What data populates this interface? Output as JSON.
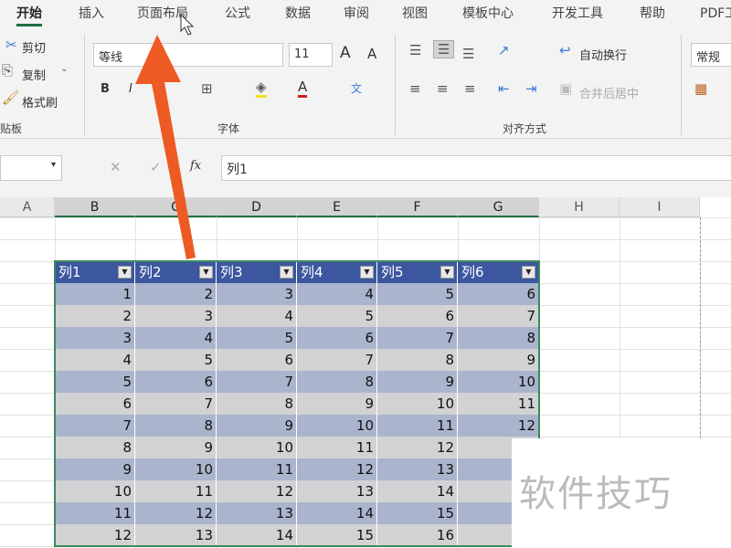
{
  "tabs": [
    "开始",
    "插入",
    "页面布局",
    "公式",
    "数据",
    "审阅",
    "视图",
    "模板中心",
    "开发工具",
    "帮助",
    "PDF工"
  ],
  "clipboard": {
    "cut": "剪切",
    "copy": "复制",
    "format_painter": "格式刷",
    "group": "贴板"
  },
  "font": {
    "name": "等线",
    "size": "11",
    "group": "字体",
    "bold": "B",
    "italic": "I",
    "underline": "U",
    "grow": "A",
    "shrink": "A"
  },
  "alignment": {
    "wrap": "自动换行",
    "merge": "合并后居中",
    "group": "对齐方式"
  },
  "number": {
    "format": "常规"
  },
  "formula_bar": {
    "fx": "fx",
    "value": "列1"
  },
  "columns": [
    "A",
    "B",
    "C",
    "D",
    "E",
    "F",
    "G",
    "H",
    "I"
  ],
  "table": {
    "headers": [
      "列1",
      "列2",
      "列3",
      "列4",
      "列5",
      "列6"
    ],
    "rows": [
      [
        1,
        2,
        3,
        4,
        5,
        6
      ],
      [
        2,
        3,
        4,
        5,
        6,
        7
      ],
      [
        3,
        4,
        5,
        6,
        7,
        8
      ],
      [
        4,
        5,
        6,
        7,
        8,
        9
      ],
      [
        5,
        6,
        7,
        8,
        9,
        10
      ],
      [
        6,
        7,
        8,
        9,
        10,
        11
      ],
      [
        7,
        8,
        9,
        10,
        11,
        12
      ],
      [
        8,
        9,
        10,
        11,
        12,
        null
      ],
      [
        9,
        10,
        11,
        12,
        13,
        null
      ],
      [
        10,
        11,
        12,
        13,
        14,
        null
      ],
      [
        11,
        12,
        13,
        14,
        15,
        null
      ],
      [
        12,
        13,
        14,
        15,
        16,
        null
      ]
    ]
  },
  "watermark": "软件技巧",
  "colors": {
    "header": "#3c56a0",
    "band_dark": "#aab4cc",
    "band_light": "#d2d2d4",
    "arrow": "#ee5a24"
  }
}
